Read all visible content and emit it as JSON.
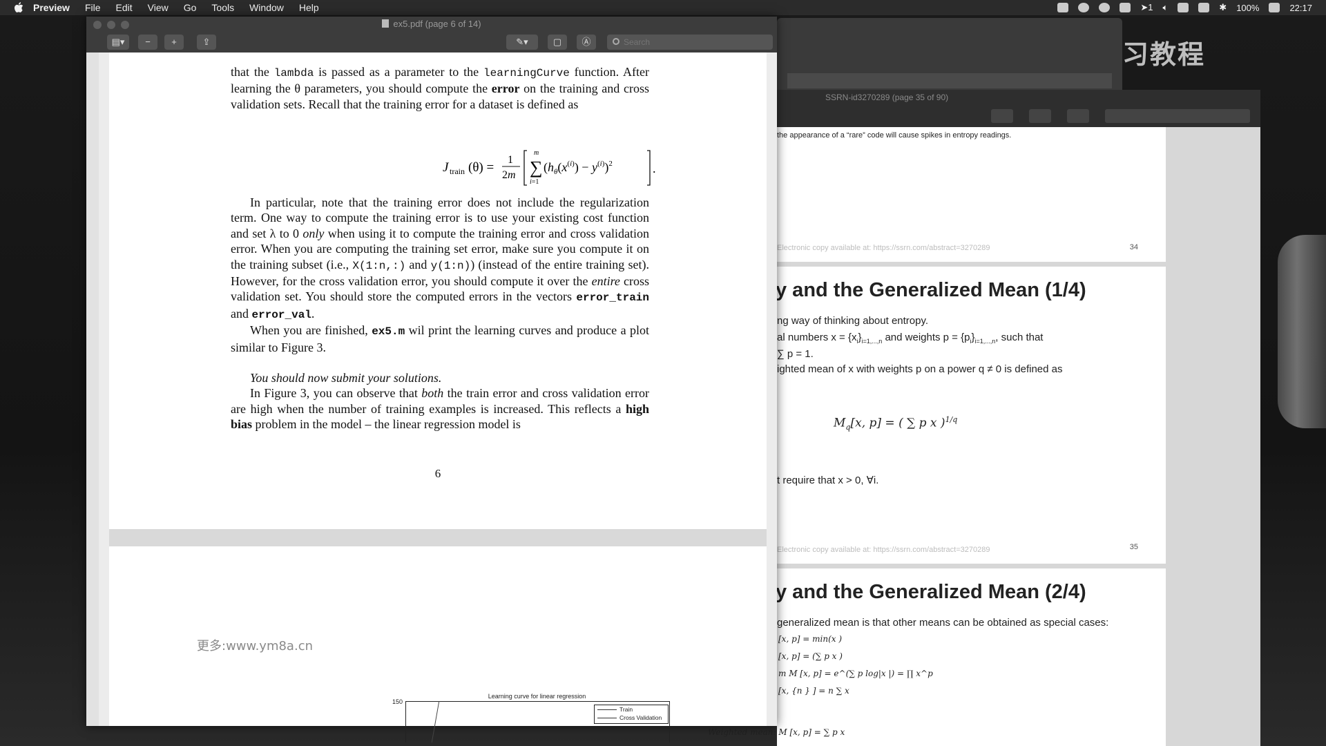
{
  "menubar": {
    "app": "Preview",
    "items": [
      "File",
      "Edit",
      "View",
      "Go",
      "Tools",
      "Window",
      "Help"
    ],
    "battery": "100%",
    "time": "22:17",
    "indicator": "1"
  },
  "desktop": {
    "watermark": "机器学习教程"
  },
  "ssrn_window": {
    "title": "SSRN-id3270289 (page 35 of 90)",
    "page34": {
      "top_text": "the appearance of a “rare” code will cause spikes in entropy readings.",
      "footer": "Electronic copy available at: https://ssrn.com/abstract=3270289",
      "page_number": "34"
    },
    "page35": {
      "title": "y and the Generalized Mean (1/4)",
      "line1": "ng way of thinking about entropy.",
      "line2_a": "al numbers x = {x",
      "line2_b": "}",
      "line2_c": " and weights p = {p",
      "line2_d": "}",
      "line2_e": ", such that",
      "sub_range": "i=1,...,n",
      "line3": "∑ p = 1.",
      "line4": "ighted mean of x with weights p on a power q ≠ 0 is defined as",
      "formula": "M",
      "formula_rest": "[x, p] = ( ∑ p x  )",
      "exponent": "1/q",
      "line5": "t require that x > 0, ∀i.",
      "footer": "Electronic copy available at: https://ssrn.com/abstract=3270289",
      "page_number": "35"
    },
    "page36": {
      "title": "y and the Generalized Mean (2/4)",
      "line1": "generalized mean is that other means can be obtained as special cases:",
      "cases": [
        "[x, p] = min(x )",
        "[x, p] = (∑ p x  )",
        "m M [x, p] = e^(∑ p log|x |) = ∏ x^p",
        "[x, {n  }   ] = n   ∑ x",
        "Weighted mean: M [x, p] = ∑ p x"
      ]
    }
  },
  "preview": {
    "title": "ex5.pdf (page 6 of 14)",
    "toolbar": {
      "sidebar_label": "▤▾",
      "zoom_out": "−",
      "zoom_in": "+",
      "share": "⇪",
      "markup": "✎▾",
      "rotate": "▢",
      "annotate": "Ⓐ"
    },
    "search_placeholder": "Search",
    "page": {
      "para1_a": "that the ",
      "lambda": "lambda",
      "para1_b": " is passed as a parameter to the ",
      "learningCurve": "learningCurve",
      "para1_c": " function.",
      "para1_d": "After learning the θ parameters, you should compute the ",
      "error_bold": "error",
      "para1_e": " on the training and cross validation sets. Recall that the training error for a dataset is defined as",
      "equation": "J_train(θ) = 1/2m [ ∑_{i=1}^{m} (h_θ(x^(i)) − y^(i))² ] .",
      "para2_a": "In particular, note that the training error does not include the regularization term. One way to compute the training error is to use your existing cost function and set λ to 0 ",
      "only": "only",
      "para2_b": " when using it to compute the training error and cross validation error. When you are computing the training set error, make sure you compute it on the training subset (i.e., ",
      "x_slice": "X(1:n,:)",
      "para2_c": " and ",
      "y_slice": "y(1:n)",
      "para2_d": ") (instead of the entire training set). However, for the cross validation error, you should compute it over the ",
      "entire": "entire",
      "para2_e": " cross validation set. You should store the computed errors in the vectors ",
      "error_train": "error_train",
      "para2_f": " and ",
      "error_val": "error_val",
      "para2_g": ".",
      "para3_a": "When you are finished, ",
      "ex5m": "ex5.m",
      "para3_b": " wil print the learning curves and produce a plot similar to Figure 3.",
      "submit": "You should now submit your solutions.",
      "para4_a": "In Figure 3, you can observe that ",
      "both": "both",
      "para4_b": " the train error and cross validation error are high when the number of training examples is increased. This reflects a ",
      "high_bias": "high bias",
      "para4_c": " problem in the model – the linear regression model is",
      "page_number": "6"
    },
    "watermark": "更多:www.ym8a.cn",
    "figure": {
      "title": "Learning curve for linear regression",
      "y_tick": "150",
      "legend": [
        "Train",
        "Cross Validation"
      ]
    }
  }
}
